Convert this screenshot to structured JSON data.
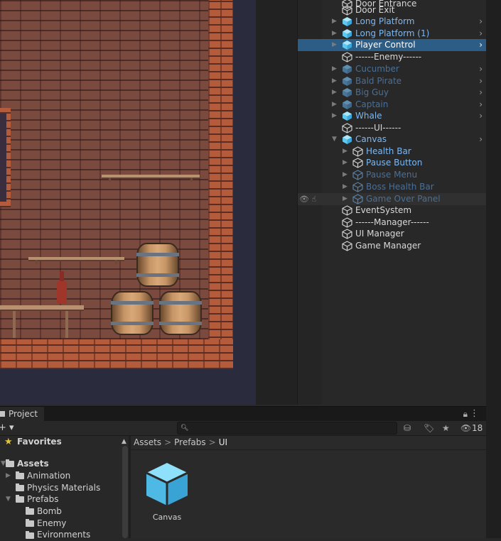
{
  "hierarchy": {
    "items": [
      {
        "label": "Door Entrance",
        "kind": "normal",
        "icon": "gameobject-cube-icon"
      },
      {
        "label": "Door Exit",
        "kind": "normal",
        "icon": "gameobject-cube-icon"
      },
      {
        "label": "Long Platform",
        "kind": "prefab",
        "icon": "prefab-cube-icon"
      },
      {
        "label": "Long Platform (1)",
        "kind": "prefab",
        "icon": "prefab-cube-icon"
      },
      {
        "label": "Player Control",
        "kind": "selected",
        "icon": "prefab-cube-icon"
      },
      {
        "label": "------Enemy------",
        "kind": "normal",
        "icon": "gameobject-cube-icon"
      },
      {
        "label": "Cucumber",
        "kind": "prefab-dim",
        "icon": "prefab-cube-icon"
      },
      {
        "label": "Bald Pirate",
        "kind": "prefab-dim",
        "icon": "prefab-cube-icon"
      },
      {
        "label": "Big Guy",
        "kind": "prefab-dim",
        "icon": "prefab-cube-icon"
      },
      {
        "label": "Captain",
        "kind": "prefab-dim",
        "icon": "prefab-cube-icon"
      },
      {
        "label": "Whale",
        "kind": "prefab",
        "icon": "prefab-cube-icon"
      },
      {
        "label": "------UI------",
        "kind": "normal",
        "icon": "gameobject-cube-icon"
      },
      {
        "label": "Canvas",
        "kind": "prefab",
        "icon": "prefab-cube-icon"
      },
      {
        "label": "Health Bar",
        "kind": "prefab",
        "icon": "gameobject-cube-icon"
      },
      {
        "label": "Pause Button",
        "kind": "prefab",
        "icon": "gameobject-cube-icon"
      },
      {
        "label": "Pause Menu",
        "kind": "prefab-dim",
        "icon": "gameobject-cube-icon"
      },
      {
        "label": "Boss Health Bar",
        "kind": "prefab-dim",
        "icon": "gameobject-cube-icon"
      },
      {
        "label": "Game Over Panel",
        "kind": "prefab-dim",
        "icon": "gameobject-cube-icon"
      },
      {
        "label": "EventSystem",
        "kind": "normal",
        "icon": "gameobject-cube-icon"
      },
      {
        "label": "------Manager------",
        "kind": "normal",
        "icon": "gameobject-cube-icon"
      },
      {
        "label": "UI Manager",
        "kind": "normal",
        "icon": "gameobject-cube-icon"
      },
      {
        "label": "Game Manager",
        "kind": "normal",
        "icon": "gameobject-cube-icon"
      }
    ]
  },
  "project": {
    "tab_label": "Project",
    "search": {
      "value": "",
      "placeholder": ""
    },
    "hidden_packages_count": "18",
    "favorites_label": "Favorites",
    "tree": {
      "assets": "Assets",
      "animation": "Animation",
      "physics_materials": "Physics Materials",
      "prefabs": "Prefabs",
      "bomb": "Bomb",
      "enemy": "Enemy",
      "evironments": "Evironments"
    },
    "breadcrumb": [
      "Assets",
      "Prefabs",
      "UI"
    ],
    "assets": [
      {
        "label": "Canvas",
        "icon": "prefab-cube-icon"
      }
    ]
  },
  "colors": {
    "selection": "#2c5d87",
    "prefab_blue": "#7cb7f0",
    "cube_fill": "#5ec8f0"
  }
}
